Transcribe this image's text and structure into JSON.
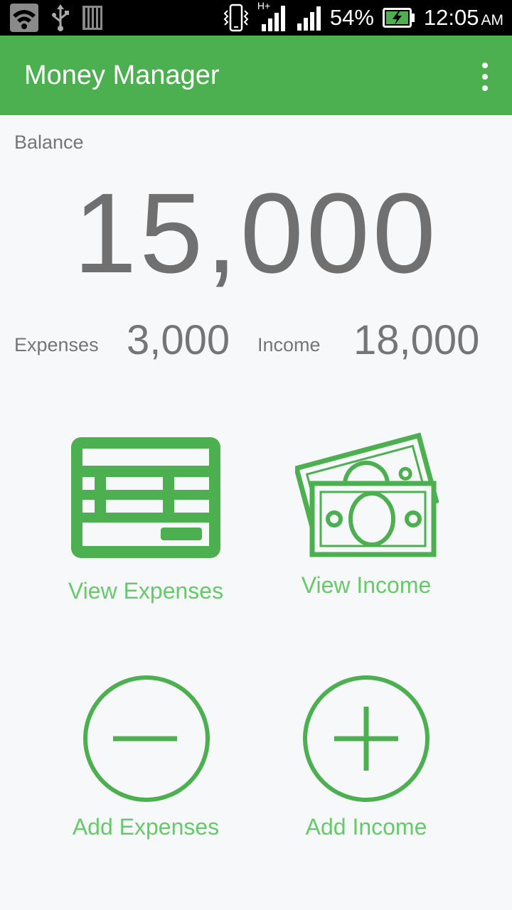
{
  "status_bar": {
    "battery": "54%",
    "time": "12:05",
    "ampm": "AM",
    "network": "H+",
    "icons": [
      "wifi-icon",
      "usb-icon",
      "sd-card-icon",
      "vibrate-icon",
      "signal-icon",
      "battery-charging-icon"
    ]
  },
  "app_bar": {
    "title": "Money Manager",
    "menu_icon": "overflow-menu-icon",
    "color": "#4caf50"
  },
  "summary": {
    "balance_label": "Balance",
    "balance_value": "15,000",
    "expenses_label": "Expenses",
    "expenses_value": "3,000",
    "income_label": "Income",
    "income_value": "18,000"
  },
  "actions": {
    "view_expenses": "View Expenses",
    "view_income": "View Income",
    "add_expenses": "Add Expenses",
    "add_income": "Add Income"
  },
  "colors": {
    "accent": "#4caf50",
    "action_text": "#66c96a",
    "muted_text": "#757575",
    "background": "#f7f8fa"
  }
}
